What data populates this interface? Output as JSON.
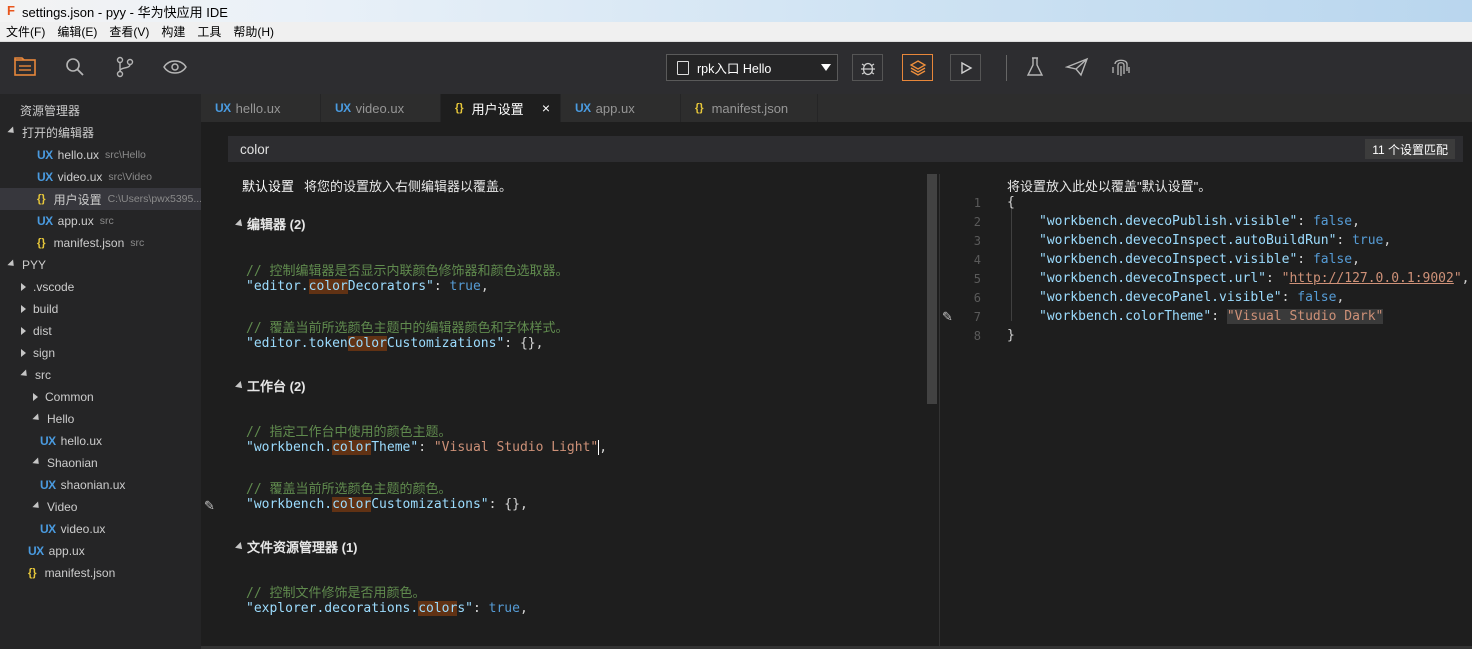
{
  "window": {
    "title": "settings.json - pyy - 华为快应用 IDE"
  },
  "menu": [
    "文件(F)",
    "编辑(E)",
    "查看(V)",
    "构建",
    "工具",
    "帮助(H)"
  ],
  "toolbar": {
    "run_target": "rpk入口 Hello",
    "accent_color": "#e8873a"
  },
  "sidebar": {
    "explorer_title": "资源管理器",
    "open_editors_title": "打开的编辑器",
    "open_editors": [
      {
        "icon": "UX",
        "name": "hello.ux",
        "path": "src\\Hello"
      },
      {
        "icon": "UX",
        "name": "video.ux",
        "path": "src\\Video"
      },
      {
        "icon": "{}",
        "name": "用户设置",
        "path": "C:\\Users\\pwx5395..."
      },
      {
        "icon": "UX",
        "name": "app.ux",
        "path": "src"
      },
      {
        "icon": "{}",
        "name": "manifest.json",
        "path": "src"
      }
    ],
    "project_title": "PYY",
    "tree": [
      {
        "name": ".vscode"
      },
      {
        "name": "build"
      },
      {
        "name": "dist"
      },
      {
        "name": "sign"
      },
      {
        "name": "src"
      },
      {
        "name": "Common"
      },
      {
        "name": "Hello"
      },
      {
        "name": "hello.ux"
      },
      {
        "name": "Shaonian"
      },
      {
        "name": "shaonian.ux"
      },
      {
        "name": "Video"
      },
      {
        "name": "video.ux"
      },
      {
        "name": "app.ux"
      },
      {
        "name": "manifest.json"
      }
    ]
  },
  "tabs": [
    {
      "icon": "UX",
      "label": "hello.ux"
    },
    {
      "icon": "UX",
      "label": "video.ux"
    },
    {
      "icon": "{}",
      "label": "用户设置",
      "close": "×"
    },
    {
      "icon": "UX",
      "label": "app.ux"
    },
    {
      "icon": "{}",
      "label": "manifest.json"
    }
  ],
  "settings": {
    "search_value": "color",
    "match_count": "11 个设置匹配",
    "left_header_title": "默认设置",
    "left_header_desc": "将您的设置放入右侧编辑器以覆盖。",
    "right_header": "将设置放入此处以覆盖\"默认设置\"。",
    "sections": [
      {
        "title": "编辑器 (2)",
        "items": [
          {
            "comment": "// 控制编辑器是否显示内联颜色修饰器和颜色选取器。",
            "key_pre": "\"editor.",
            "key_hl": "color",
            "key_post": "Decorators\"",
            "value": "true",
            "value_type": "kw"
          },
          {
            "comment": "// 覆盖当前所选颜色主题中的编辑器颜色和字体样式。",
            "key_pre": "\"editor.token",
            "key_hl": "Color",
            "key_post": "Customizations\"",
            "value": "{}",
            "value_type": "punc"
          }
        ]
      },
      {
        "title": "工作台 (2)",
        "items": [
          {
            "comment": "// 指定工作台中使用的颜色主题。",
            "key_pre": "\"workbench.",
            "key_hl": "color",
            "key_post": "Theme\"",
            "value": "\"Visual Studio Light\"",
            "value_type": "str"
          },
          {
            "comment": "// 覆盖当前所选颜色主题的颜色。",
            "key_pre": "\"workbench.",
            "key_hl": "color",
            "key_post": "Customizations\"",
            "value": "{}",
            "value_type": "punc"
          }
        ]
      },
      {
        "title": "文件资源管理器 (1)",
        "items": [
          {
            "comment": "// 控制文件修饰是否用颜色。",
            "key_pre": "\"explorer.decorations.",
            "key_hl": "color",
            "key_post": "s\"",
            "value": "true",
            "value_type": "kw"
          }
        ]
      }
    ],
    "user_json": {
      "line_numbers": [
        "1",
        "2",
        "3",
        "4",
        "5",
        "6",
        "7",
        "8"
      ],
      "open": "{",
      "close": "}",
      "entries": [
        {
          "key": "\"workbench.devecoPublish.visible\"",
          "value": "false",
          "type": "kw"
        },
        {
          "key": "\"workbench.devecoInspect.autoBuildRun\"",
          "value": "true",
          "type": "kw"
        },
        {
          "key": "\"workbench.devecoInspect.visible\"",
          "value": "false",
          "type": "kw"
        },
        {
          "key": "\"workbench.devecoInspect.url\"",
          "value": "http://127.0.0.1:9002",
          "type": "link"
        },
        {
          "key": "\"workbench.devecoPanel.visible\"",
          "value": "false",
          "type": "kw"
        },
        {
          "key": "\"workbench.colorTheme\"",
          "value": "\"Visual Studio Dark\"",
          "type": "str"
        }
      ]
    }
  }
}
